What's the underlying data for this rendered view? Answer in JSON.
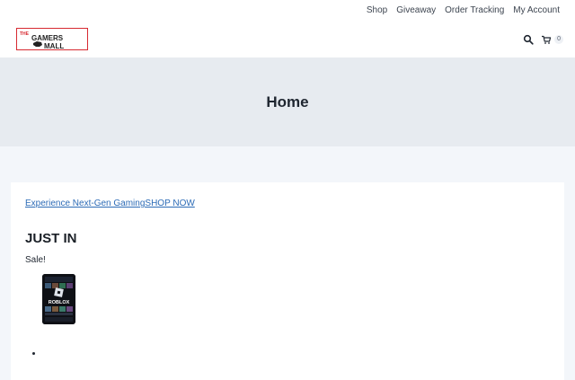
{
  "nav": {
    "items": [
      {
        "label": "Shop"
      },
      {
        "label": "Giveaway"
      },
      {
        "label": "Order Tracking"
      },
      {
        "label": "My Account"
      }
    ]
  },
  "logo": {
    "line1": "THE",
    "line2": "GAMERS",
    "line3": "MALL",
    "color": "#d72a31"
  },
  "header": {
    "search_icon": "search-icon",
    "cart_icon": "cart-icon",
    "cart_count": "0"
  },
  "hero": {
    "title": "Home"
  },
  "content": {
    "promo_text": "Experience Next-Gen Gaming",
    "promo_cta": "SHOP NOW",
    "section_title": "JUST IN",
    "sale_label": "Sale!",
    "product": {
      "brand": "ROBLOX"
    }
  },
  "colors": {
    "link": "#2c6bb6",
    "accent": "#d72a31",
    "hero_bg": "#e7ebf0"
  }
}
